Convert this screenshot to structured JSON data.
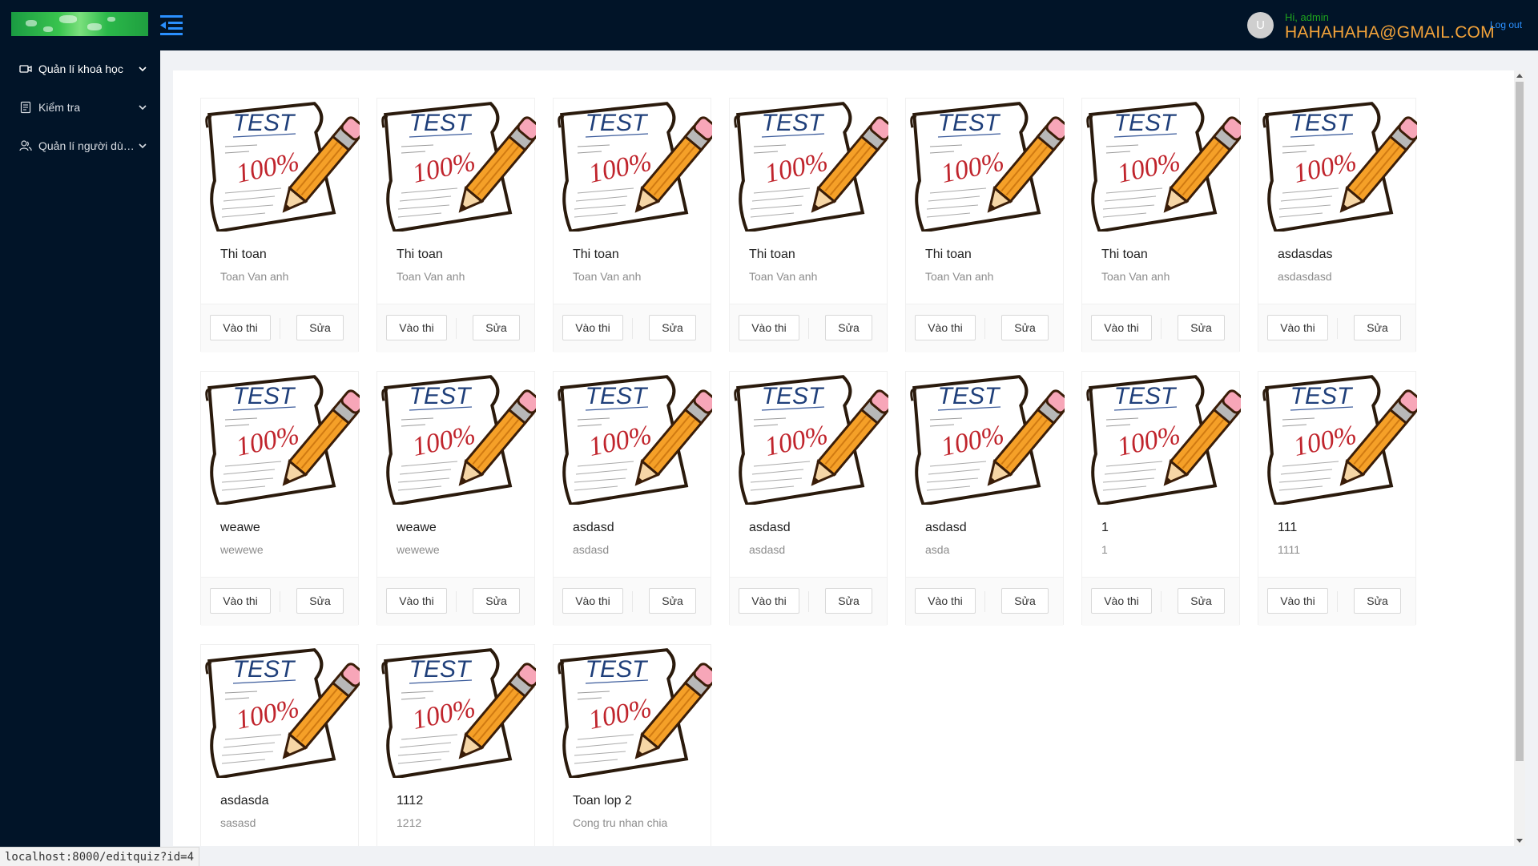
{
  "header": {
    "logo": "logo-image",
    "greeting": "Hi, admin",
    "email": "HAHAHAHA@GMAIL.COM",
    "avatar_letter": "U",
    "logout": "Log out"
  },
  "sidebar": {
    "items": [
      {
        "label": "Quản lí khoá học",
        "icon": "video-camera-icon"
      },
      {
        "label": "Kiểm tra",
        "icon": "document-list-icon"
      },
      {
        "label": "Quản lí người dùng",
        "icon": "users-icon"
      }
    ]
  },
  "quiz_image": {
    "header_text": "TEST",
    "score_text": "100%"
  },
  "buttons": {
    "enter": "Vào thi",
    "edit": "Sửa"
  },
  "quizzes": [
    {
      "title": "Thi toan",
      "description": "Toan Van anh"
    },
    {
      "title": "Thi toan",
      "description": "Toan Van anh"
    },
    {
      "title": "Thi toan",
      "description": "Toan Van anh"
    },
    {
      "title": "Thi toan",
      "description": "Toan Van anh"
    },
    {
      "title": "Thi toan",
      "description": "Toan Van anh"
    },
    {
      "title": "Thi toan",
      "description": "Toan Van anh"
    },
    {
      "title": "asdasdas",
      "description": "asdasdasd"
    },
    {
      "title": "weawe",
      "description": "wewewe"
    },
    {
      "title": "weawe",
      "description": "wewewe"
    },
    {
      "title": "asdasd",
      "description": "asdasd"
    },
    {
      "title": "asdasd",
      "description": "asdasd"
    },
    {
      "title": "asdasd",
      "description": "asda"
    },
    {
      "title": "1",
      "description": "1"
    },
    {
      "title": "111",
      "description": "1111"
    },
    {
      "title": "asdasda",
      "description": "sasasd"
    },
    {
      "title": "1112",
      "description": "1212"
    },
    {
      "title": "Toan lop 2",
      "description": "Cong tru nhan chia"
    }
  ],
  "status_url": "localhost:8000/editquiz?id=4",
  "colors": {
    "topbar": "#011428",
    "greeting": "#1ea21e",
    "email": "#f3a33a",
    "logout": "#2a90ff",
    "menu_toggle": "#2a90ff"
  }
}
